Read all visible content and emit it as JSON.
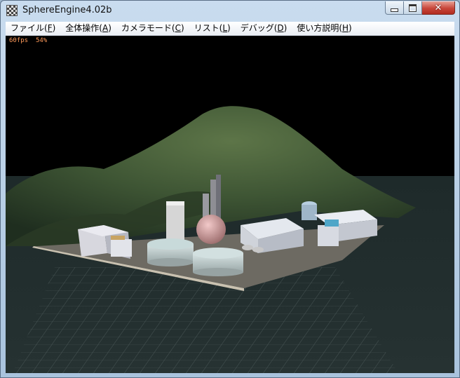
{
  "window": {
    "title": "SphereEngine4.02b",
    "close_glyph": "✕"
  },
  "menu": [
    {
      "label": "ファイル(",
      "mnemonic": "F",
      "close": ")"
    },
    {
      "label": "全体操作(",
      "mnemonic": "A",
      "close": ")"
    },
    {
      "label": "カメラモード(",
      "mnemonic": "C",
      "close": ")"
    },
    {
      "label": "リスト(",
      "mnemonic": "L",
      "close": ")"
    },
    {
      "label": "デバッグ(",
      "mnemonic": "D",
      "close": ")"
    },
    {
      "label": "使い方説明(",
      "mnemonic": "H",
      "close": ")"
    }
  ],
  "viewport": {
    "fps": "60fps",
    "load": "54%"
  },
  "icons": {
    "app": "app-icon",
    "minimize": "minimize-icon",
    "maximize": "maximize-icon",
    "close": "close-icon"
  }
}
